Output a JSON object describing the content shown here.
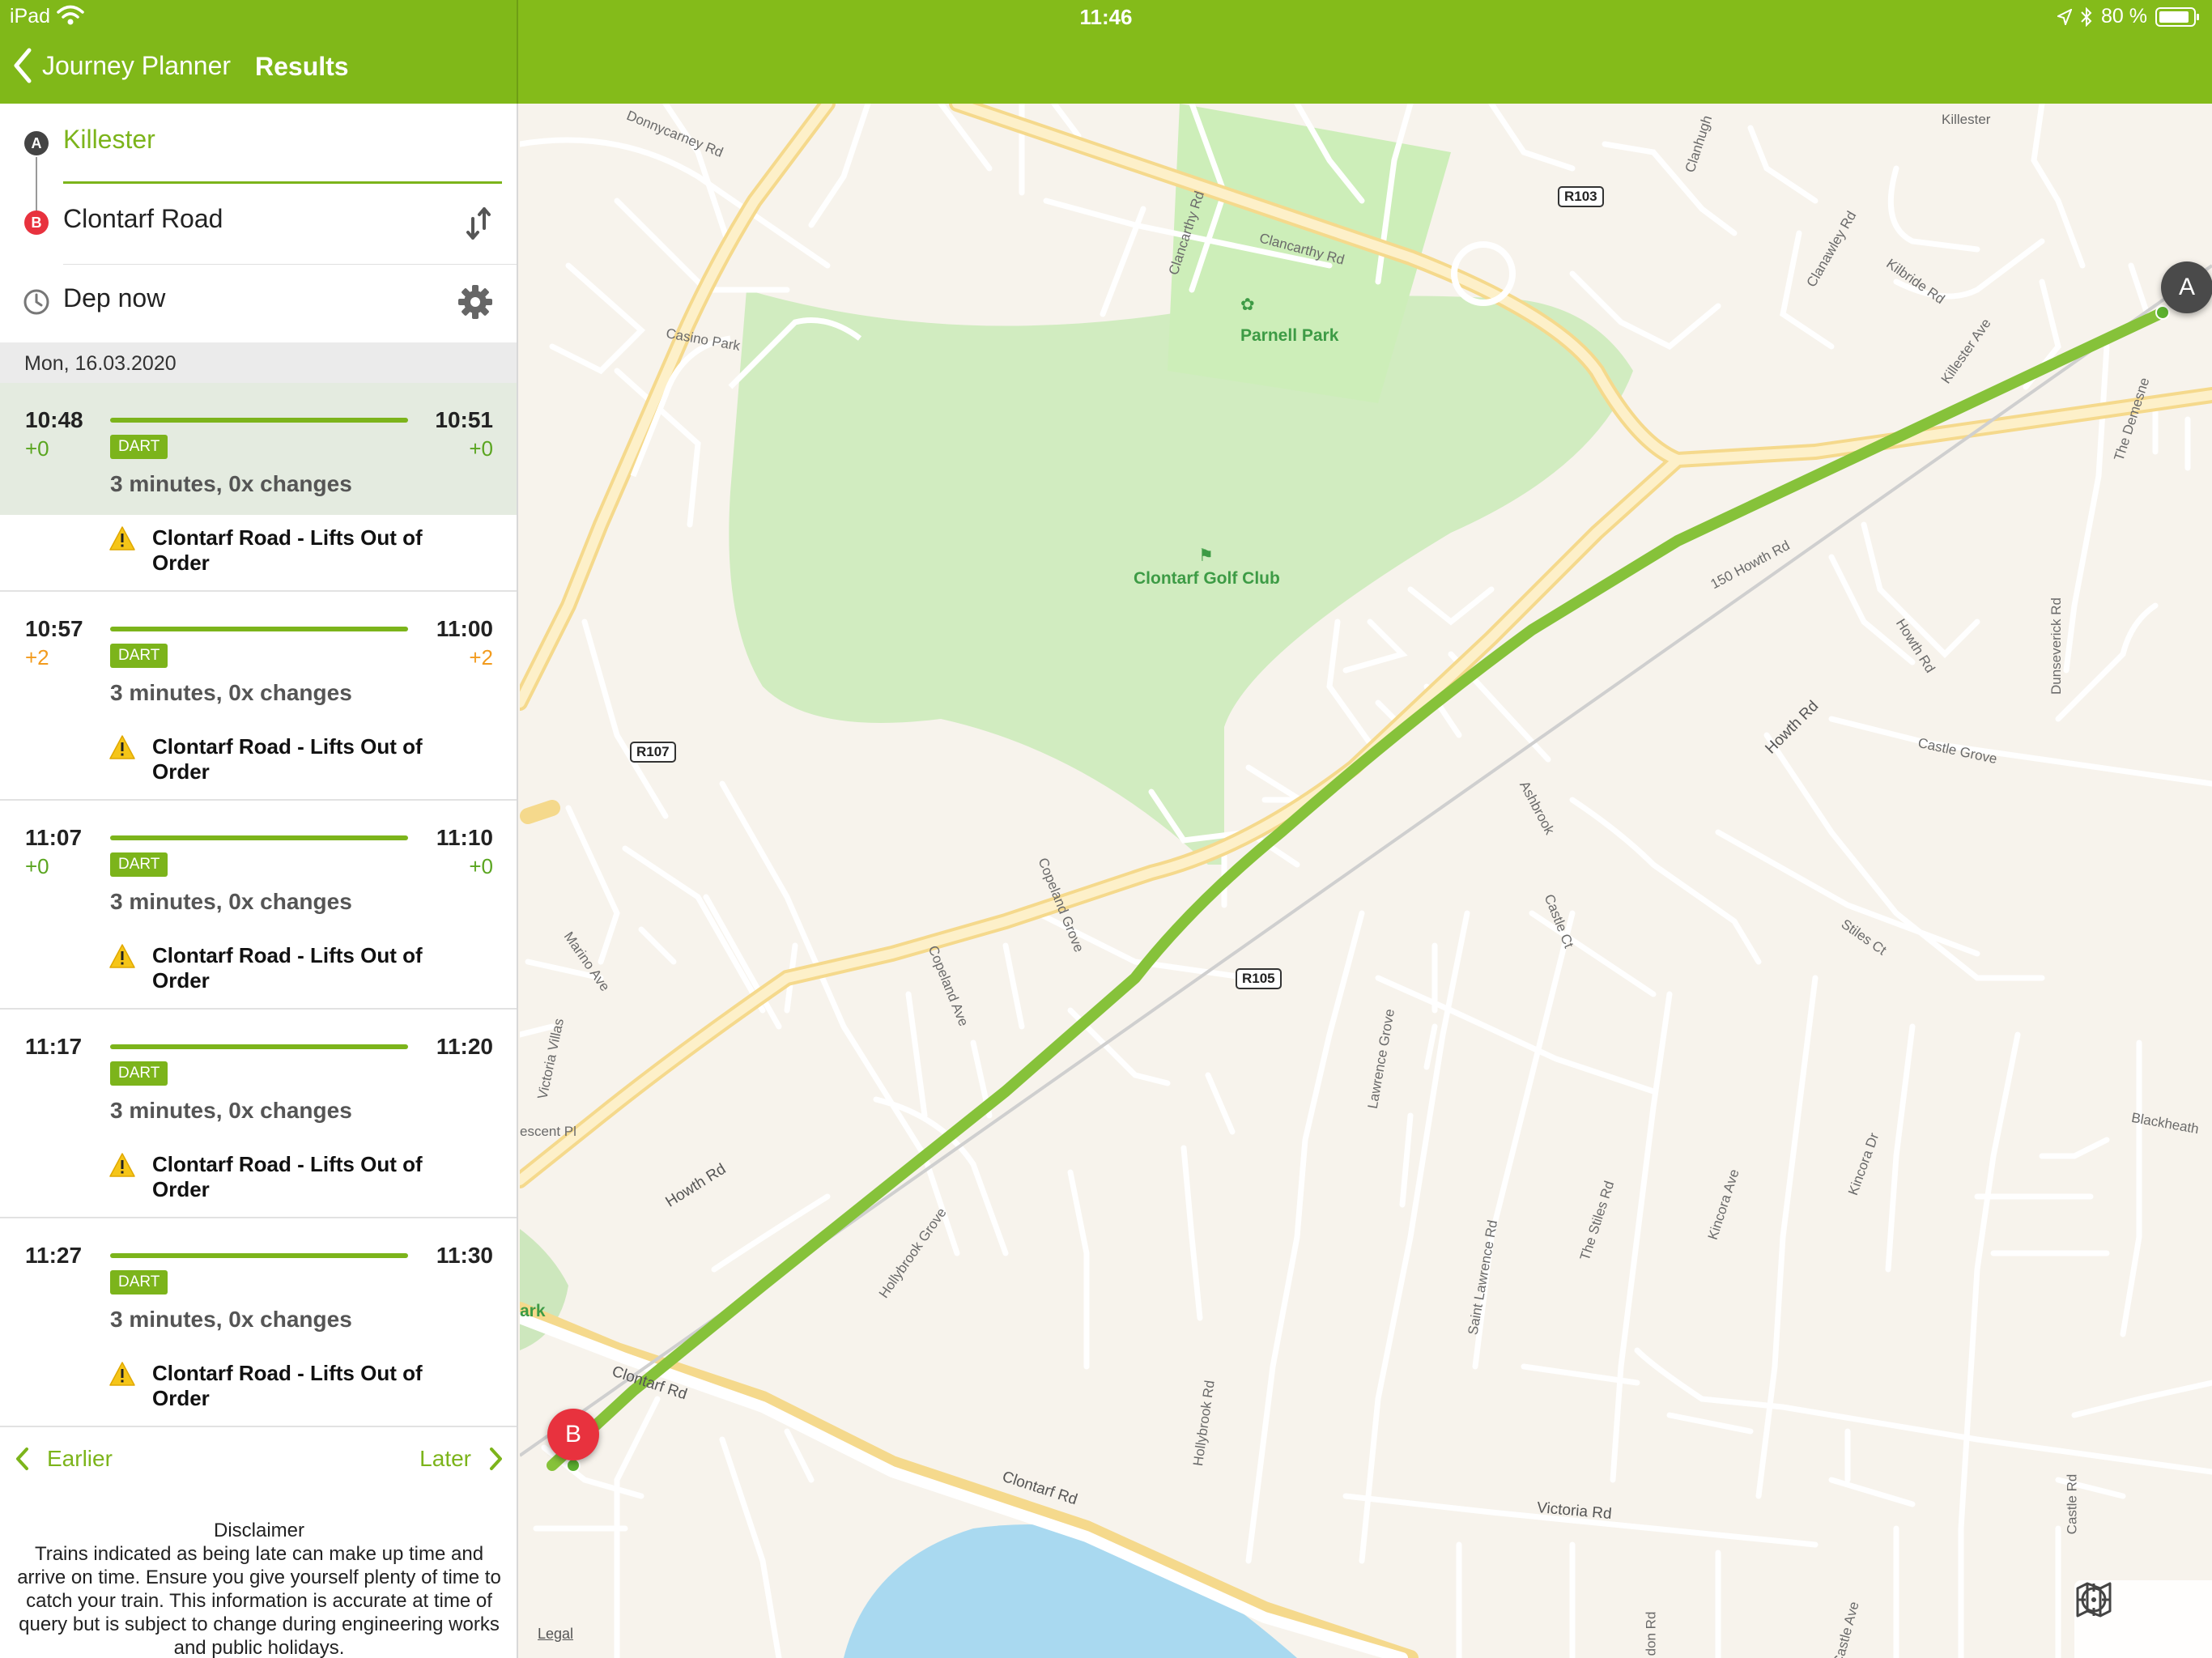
{
  "status_bar": {
    "device": "iPad",
    "time": "11:46",
    "battery": "80 %"
  },
  "nav": {
    "back_label": "Journey Planner",
    "title": "Results"
  },
  "search": {
    "origin": "Killester",
    "origin_marker": "A",
    "destination": "Clontarf Road",
    "destination_marker": "B",
    "departure": "Dep now"
  },
  "date": "Mon, 16.03.2020",
  "results": [
    {
      "dep": "10:48",
      "dep_delay": "+0",
      "arr": "10:51",
      "arr_delay": "+0",
      "mode": "DART",
      "info": "3 minutes,  0x changes",
      "alert": "Clontarf Road - Lifts Out of Order"
    },
    {
      "dep": "10:57",
      "dep_delay": "+2",
      "arr": "11:00",
      "arr_delay": "+2",
      "mode": "DART",
      "info": "3 minutes,  0x changes",
      "alert": "Clontarf Road - Lifts Out of Order"
    },
    {
      "dep": "11:07",
      "dep_delay": "+0",
      "arr": "11:10",
      "arr_delay": "+0",
      "mode": "DART",
      "info": "3 minutes,  0x changes",
      "alert": "Clontarf Road - Lifts Out of Order"
    },
    {
      "dep": "11:17",
      "dep_delay": "",
      "arr": "11:20",
      "arr_delay": "",
      "mode": "DART",
      "info": "3 minutes,  0x changes",
      "alert": "Clontarf Road - Lifts Out of Order"
    },
    {
      "dep": "11:27",
      "dep_delay": "",
      "arr": "11:30",
      "arr_delay": "",
      "mode": "DART",
      "info": "3 minutes,  0x changes",
      "alert": "Clontarf Road - Lifts Out of Order"
    }
  ],
  "pager": {
    "earlier": "Earlier",
    "later": "Later"
  },
  "disclaimer": {
    "title": "Disclaimer",
    "text": "Trains indicated as being late can make up time and arrive on time. Ensure you give yourself plenty of time to catch your train. This information is accurate at time of query but is subject to change during engineering works and public holidays."
  },
  "map": {
    "pin_a": "A",
    "pin_b": "B",
    "legal": "Legal",
    "places": {
      "parnell_park": "Parnell Park",
      "golf_club": "Clontarf Golf Club",
      "killester": "Killester",
      "park_fragment": "ark"
    },
    "roads": {
      "r103": "R103",
      "r107": "R107",
      "r105": "R105",
      "donnycarney": "Donnycarney Rd",
      "clancarthy1": "Clancarthy Rd",
      "clancarthy2": "Clancarthy Rd",
      "casino_park": "Casino Park",
      "clanhugh": "Clanhugh",
      "clanawley": "Clanawley Rd",
      "kilbride": "Kilbride Rd",
      "killester_ave": "Killester Ave",
      "the_demesne": "The Demesne",
      "howth_150": "150 Howth Rd",
      "howth_rd_1": "Howth Rd",
      "howth_rd_2": "Howth Rd",
      "howth_rd_3": "Howth Rd",
      "dunseverick": "Dunseverick Rd",
      "castle_grove": "Castle Grove",
      "ashbrook": "Ashbrook",
      "castle_ct": "Castle Ct",
      "stiles_ct": "Stiles Ct",
      "copeland_grove": "Copeland Grove",
      "copeland_ave": "Copeland Ave",
      "marino_ave": "Marino Ave",
      "victoria_villas": "Victoria Villas",
      "crescent_pl": "escent Pl",
      "lawrence_grove": "Lawrence Grove",
      "blackheath": "Blackheath",
      "hollybrook_grove": "Hollybrook Grove",
      "saint_lawrence": "Saint Lawrence Rd",
      "the_stiles": "The Stiles Rd",
      "kincora_ave": "Kincora Ave",
      "kincora_dr": "Kincora Dr",
      "clontarf_rd_1": "Clontarf Rd",
      "clontarf_rd_2": "Clontarf Rd",
      "hollybrook_rd": "Hollybrook Rd",
      "victoria_rd": "Victoria Rd",
      "castle_ave": "Castle Ave",
      "castle_rd": "Castle Rd",
      "don_rd": "don Rd"
    }
  },
  "colors": {
    "brand_green": "#84bb1a",
    "route_green": "#86c23a",
    "ontime": "#5aa520",
    "late": "#f29b1e",
    "marker_b": "#e8323e",
    "warning": "#f5c518"
  }
}
